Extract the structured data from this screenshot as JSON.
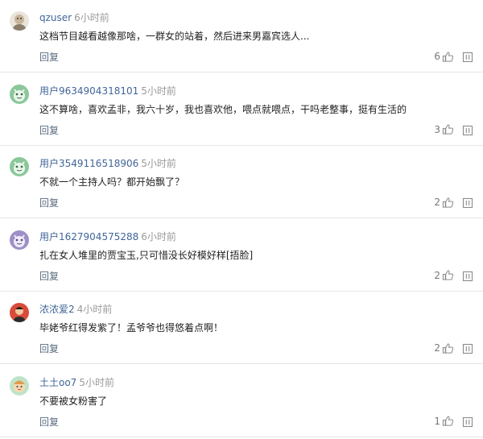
{
  "reply_label": "回复",
  "comments": [
    {
      "avatar": "avatar-illustration",
      "username": "qzuser",
      "time": "6小时前",
      "text": "这档节目越看越像那啥，一群女的站着，然后进来男嘉宾选人...",
      "likes": "6"
    },
    {
      "avatar": "avatar-green-default",
      "username": "用户9634904318101",
      "time": "5小时前",
      "text": "这不算啥，喜欢孟非，我六十岁，我也喜欢他，喂点就喂点，干吗老整事，挺有生活的",
      "likes": "3"
    },
    {
      "avatar": "avatar-green-default",
      "username": "用户3549116518906",
      "time": "5小时前",
      "text": "不就一个主持人吗？都开始飘了？",
      "likes": "2"
    },
    {
      "avatar": "avatar-purple-default",
      "username": "用户1627904575288",
      "time": "6小时前",
      "text": "扎在女人堆里的贾宝玉,只可惜没长好模好样[捂脸]",
      "likes": "2"
    },
    {
      "avatar": "avatar-photo",
      "username": "浓浓爱2",
      "time": "4小时前",
      "text": "毕姥爷红得发紫了！孟爷爷也得悠着点啊！",
      "likes": "2"
    },
    {
      "avatar": "avatar-cartoon",
      "username": "土土oo7",
      "time": "5小时前",
      "text": "不要被女粉害了",
      "likes": "1"
    }
  ]
}
